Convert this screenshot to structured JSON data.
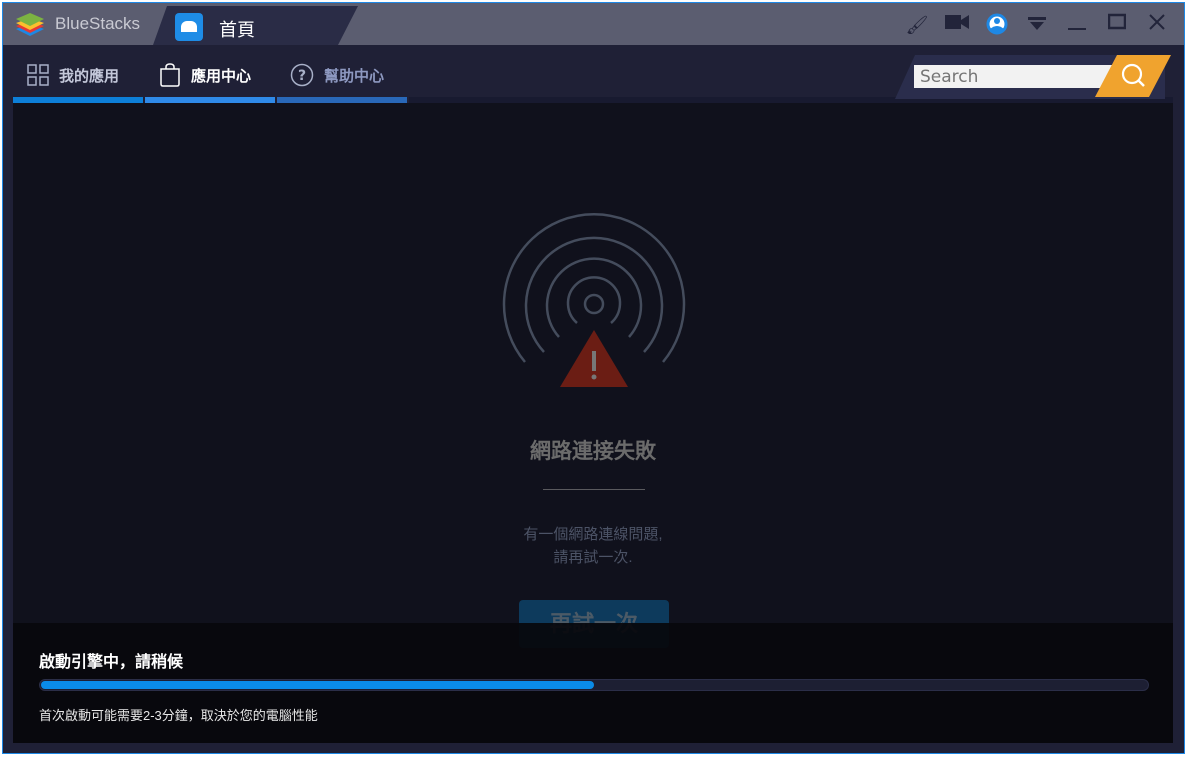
{
  "titlebar": {
    "brand": "BlueStacks",
    "tab_label": "首頁",
    "icons": [
      "brush-icon",
      "cast-camera-icon",
      "account-icon",
      "dropdown-icon",
      "minimize-icon",
      "maximize-icon",
      "close-icon"
    ]
  },
  "nav": {
    "items": [
      {
        "label": "我的應用",
        "icon": "grid-icon"
      },
      {
        "label": "應用中心",
        "icon": "bag-icon"
      },
      {
        "label": "幫助中心",
        "icon": "help-icon"
      }
    ],
    "search_placeholder": "Search"
  },
  "error": {
    "title": "網路連接失敗",
    "message_line1": "有一個網路連線問題,",
    "message_line2": "請再試一次.",
    "retry_label": "再試一次"
  },
  "boot": {
    "status": "啟動引擎中，請稍候",
    "progress_percent": 50,
    "hint": "首次啟動可能需要2-3分鐘，取決於您的電腦性能"
  },
  "colors": {
    "accent": "#1e88e5",
    "search_button": "#f0a32e",
    "warning": "#6b1d14"
  }
}
